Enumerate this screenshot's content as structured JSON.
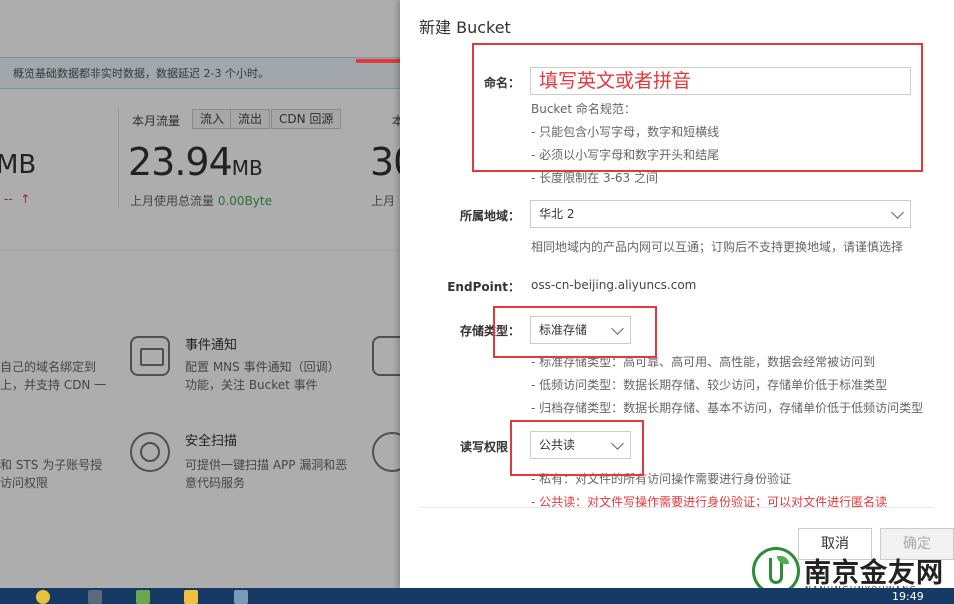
{
  "background": {
    "notice": "概览基础数据都非实时数据，数据延迟 2-3 个小时。",
    "left_partial_value": "MB",
    "left_partial_sub": "--",
    "left_partial_arrow": "↑",
    "traffic": {
      "title": "本月流量",
      "tabs": [
        "流入",
        "流出",
        "CDN 回源"
      ],
      "value": "23.94",
      "unit": "MB",
      "sub_label": "上月使用总流量",
      "sub_value": "0.00Byte"
    },
    "right_partial_title": "本",
    "right_partial_value": "30",
    "right_partial_sub": "上月",
    "cards": [
      {
        "title": "",
        "desc1": "自己的域名绑定到",
        "desc2": "上，并支持 CDN 一"
      },
      {
        "title": "事件通知",
        "desc1": "配置 MNS 事件通知（回调）",
        "desc2": "功能，关注 Bucket 事件"
      },
      {
        "title": "",
        "desc1": "和 STS 为子账号授",
        "desc2": "访问权限"
      },
      {
        "title": "安全扫描",
        "desc1": "可提供一键扫描 APP 漏洞和恶",
        "desc2": "意代码服务"
      }
    ]
  },
  "dialog": {
    "title": "新建 Bucket",
    "name": {
      "label": "命名：",
      "value": "填写英文或者拼音",
      "rules_title": "Bucket 命名规范：",
      "rules": [
        "- 只能包含小写字母，数字和短横线",
        "- 必须以小写字母和数字开头和结尾",
        "- 长度限制在 3-63 之间"
      ]
    },
    "region": {
      "label": "所属地域：",
      "value": "华北 2",
      "hint": "相同地域内的产品内网可以互通；订购后不支持更换地域，请谨慎选择"
    },
    "endpoint": {
      "label": "EndPoint：",
      "value": "oss-cn-beijing.aliyuncs.com"
    },
    "storage": {
      "label": "存储类型：",
      "value": "标准存储",
      "hints": [
        "- 标准存储类型：高可靠、高可用、高性能，数据会经常被访问到",
        "- 低频访问类型：数据长期存储、较少访问，存储单价低于标准类型",
        "- 归档存储类型：数据长期存储、基本不访问，存储单价低于低频访问类型"
      ]
    },
    "acl": {
      "label": "读写权限：",
      "value": "公共读",
      "hints": [
        "- 私有：对文件的所有访问操作需要进行身份验证",
        "- 公共读：对文件写操作需要进行身份验证；可以对文件进行匿名读"
      ]
    },
    "buttons": {
      "cancel": "取消",
      "confirm": "确定"
    }
  },
  "watermark": {
    "name": "南京金友网",
    "pinyin": "NANJINGJINYOUWANG"
  },
  "taskbar": {
    "clock": "19:49"
  },
  "colors": {
    "highlight": "#e4393c",
    "taskbar": "#163a63",
    "watermark_green": "#2e8b3a"
  }
}
